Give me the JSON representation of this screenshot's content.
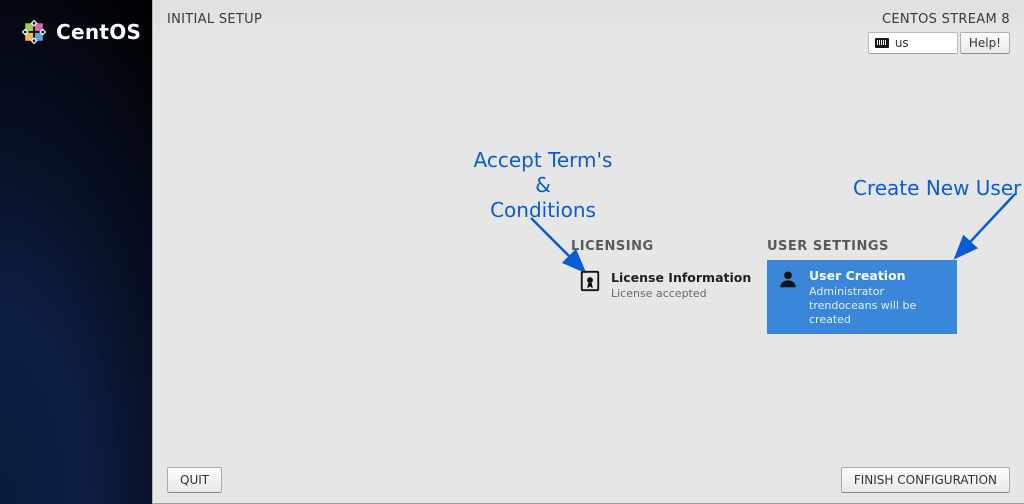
{
  "brand": {
    "name": "CentOS"
  },
  "topbar": {
    "title": "INITIAL SETUP",
    "distro": "CENTOS STREAM 8",
    "keyboard_layout": "us",
    "help_label": "Help!"
  },
  "sections": {
    "licensing": {
      "heading": "LICENSING",
      "spoke_title": "License Information",
      "spoke_status": "License accepted"
    },
    "user": {
      "heading": "USER SETTINGS",
      "spoke_title": "User Creation",
      "spoke_status": "Administrator trendoceans will be created"
    }
  },
  "annotations": {
    "accept_terms": "Accept Term's\n&\nConditions",
    "create_user": "Create New User"
  },
  "bottombar": {
    "quit_label": "QUIT",
    "finish_label": "FINISH CONFIGURATION"
  },
  "colors": {
    "accent": "#3a86d8",
    "annotation": "#0a5cd6"
  }
}
